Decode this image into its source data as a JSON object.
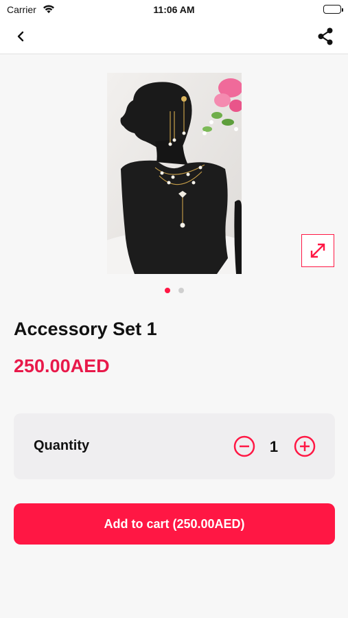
{
  "status_bar": {
    "carrier": "Carrier",
    "time": "11:06 AM",
    "battery_level": 1.0
  },
  "nav": {
    "back_icon": "chevron-left-icon",
    "share_icon": "share-icon"
  },
  "gallery": {
    "image_alt": "product-photo",
    "expand_icon": "expand-arrows-icon",
    "page_count": 2,
    "active_page": 1
  },
  "product": {
    "title": "Accessory Set 1",
    "price": "250.00AED"
  },
  "quantity": {
    "label": "Quantity",
    "value": "1",
    "minus_icon": "minus-circle-icon",
    "plus_icon": "plus-circle-icon"
  },
  "cart": {
    "button_label": "Add to cart (250.00AED)"
  },
  "colors": {
    "accent": "#ff1744",
    "price": "#e8194a",
    "background": "#f7f7f7",
    "card": "#efeef0"
  }
}
